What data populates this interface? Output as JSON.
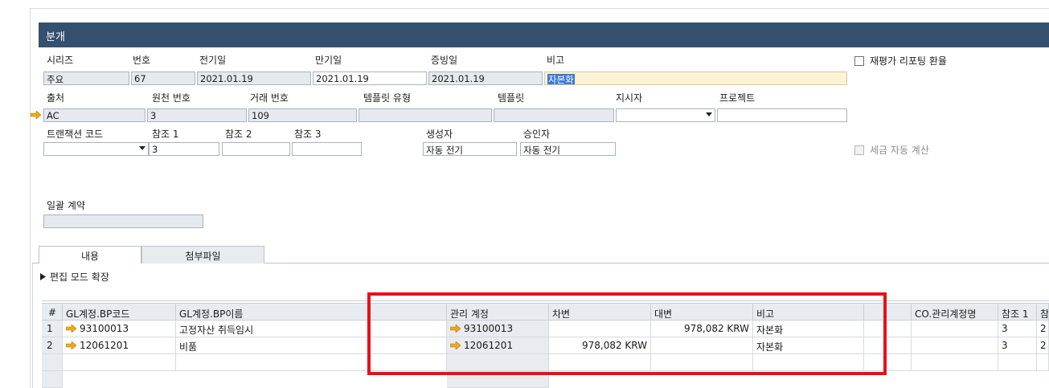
{
  "window": {
    "title": "분개"
  },
  "header": {
    "series": {
      "label": "시리즈",
      "value": "주요"
    },
    "number": {
      "label": "번호",
      "value": "67"
    },
    "posting_date": {
      "label": "전기일",
      "value": "2021.01.19"
    },
    "due_date": {
      "label": "만기일",
      "value": "2021.01.19"
    },
    "doc_date": {
      "label": "증빙일",
      "value": "2021.01.19"
    },
    "remarks": {
      "label": "비고",
      "value": "자본화"
    },
    "origin": {
      "label": "출처",
      "value": "AC"
    },
    "origin_no": {
      "label": "원천 번호",
      "value": "3"
    },
    "trans_no": {
      "label": "거래 번호",
      "value": "109"
    },
    "template_type": {
      "label": "템플릿 유형",
      "value": ""
    },
    "template": {
      "label": "템플릿",
      "value": ""
    },
    "indicator": {
      "label": "지시자",
      "value": ""
    },
    "project": {
      "label": "프로젝트",
      "value": ""
    },
    "trans_code": {
      "label": "트랜잭션 코드",
      "value": ""
    },
    "ref1": {
      "label": "참조 1",
      "value": "3"
    },
    "ref2": {
      "label": "참조 2",
      "value": ""
    },
    "ref3": {
      "label": "참조 3",
      "value": ""
    },
    "creator": {
      "label": "생성자",
      "value": "자동 전기"
    },
    "approver": {
      "label": "승인자",
      "value": "자동 전기"
    },
    "blanket": {
      "label": "일괄 계약",
      "value": ""
    },
    "revaluation": {
      "label": "재평가 리포팅 환율"
    },
    "auto_tax": {
      "label": "세금 자동 계산"
    }
  },
  "tabs": [
    {
      "label": "내용"
    },
    {
      "label": "첨부파일"
    }
  ],
  "expand_label": "편집 모드 확장",
  "grid": {
    "columns": [
      "#",
      "GL계정.BP코드",
      "GL계정.BP이름",
      "",
      "관리 계정",
      "차변",
      "대변",
      "비고",
      "",
      "CO.관리계정명",
      "참조 1",
      "참조"
    ],
    "rows": [
      {
        "num": "1",
        "code": "93100013",
        "name": "고정자산 취득임시",
        "control": "93100013",
        "debit": "",
        "credit": "978,082 KRW",
        "remark": "자본화",
        "ref1": "3",
        "ref2": "2"
      },
      {
        "num": "2",
        "code": "12061201",
        "name": "비품",
        "control": "12061201",
        "debit": "978,082 KRW",
        "credit": "",
        "remark": "자본화",
        "ref1": "3",
        "ref2": "2"
      }
    ]
  },
  "colors": {
    "title_bar": "#34506e",
    "link_arrow": "#f0a818",
    "highlight_box": "#e8101b"
  }
}
